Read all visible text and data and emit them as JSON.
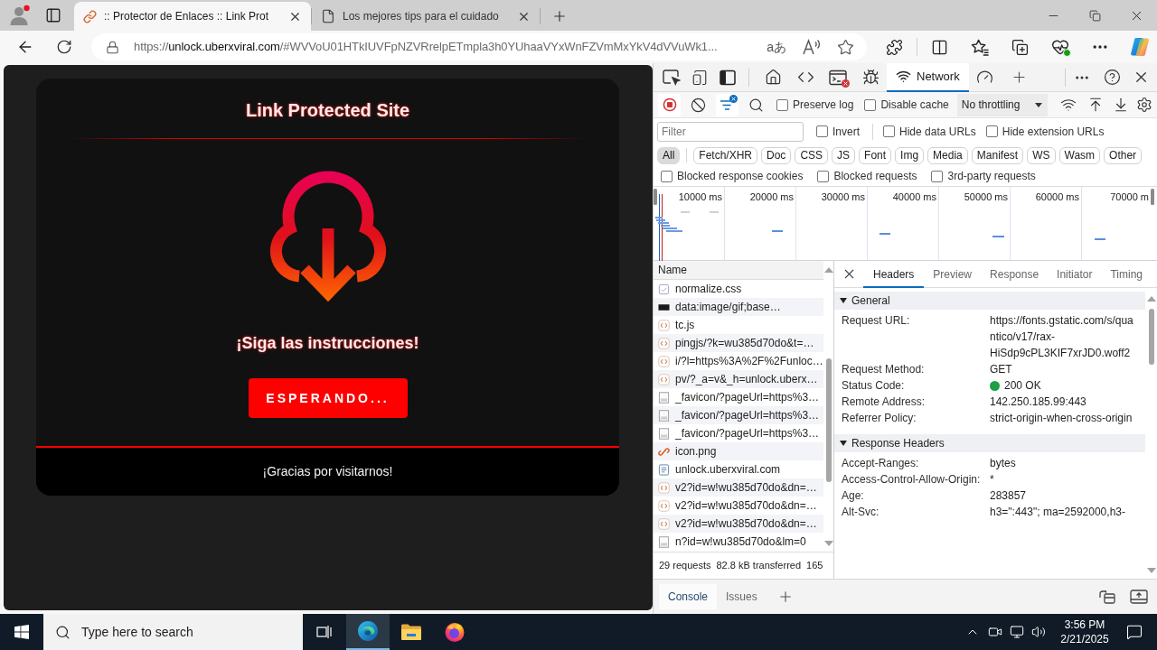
{
  "browser": {
    "tabs": [
      {
        "title": ":: Protector de Enlaces :: Link Prot",
        "kind": "link",
        "selected": true
      },
      {
        "title": "Los mejores tips para el cuidado",
        "kind": "page",
        "selected": false
      }
    ],
    "address": {
      "scheme": "https://",
      "host": "unlock.uberxviral.com",
      "path": "/#WVVoU01HTkIUVFpNZVRrelpETmpla3h0YUhaaVYxWnFZVmMxYkV4dVVuWk1...",
      "translate_glyph": "aあ"
    }
  },
  "page": {
    "title": "Link Protected Site",
    "message": "¡Siga las instrucciones!",
    "button": "ESPERANDO...",
    "footer": "¡Gracias por visitarnos!"
  },
  "devtools": {
    "panels": [
      {
        "kind": "welcome",
        "selected": false
      },
      {
        "kind": "elements",
        "selected": false
      },
      {
        "kind": "console",
        "selected": false,
        "has_errors": true
      },
      {
        "kind": "sources",
        "selected": false
      },
      {
        "kind": "network",
        "label": "Network",
        "selected": true
      },
      {
        "kind": "performance",
        "selected": false
      }
    ],
    "toolbar": {
      "recording": true,
      "filter_badge": true,
      "options": [
        {
          "label": "Preserve log",
          "checked": false
        },
        {
          "label": "Disable cache",
          "checked": false
        }
      ],
      "throttling": "No throttling"
    },
    "filter": {
      "placeholder": "Filter",
      "options": [
        {
          "label": "Invert",
          "checked": false
        },
        {
          "label": "Hide data URLs",
          "checked": false
        },
        {
          "label": "Hide extension URLs",
          "checked": false
        }
      ]
    },
    "types": [
      {
        "label": "All",
        "selected": true
      },
      {
        "label": "Fetch/XHR",
        "selected": false
      },
      {
        "label": "Doc",
        "selected": false
      },
      {
        "label": "CSS",
        "selected": false
      },
      {
        "label": "JS",
        "selected": false
      },
      {
        "label": "Font",
        "selected": false
      },
      {
        "label": "Img",
        "selected": false
      },
      {
        "label": "Media",
        "selected": false
      },
      {
        "label": "Manifest",
        "selected": false
      },
      {
        "label": "WS",
        "selected": false
      },
      {
        "label": "Wasm",
        "selected": false
      },
      {
        "label": "Other",
        "selected": false
      }
    ],
    "blocked": [
      {
        "label": "Blocked response cookies",
        "checked": false
      },
      {
        "label": "Blocked requests",
        "checked": false
      },
      {
        "label": "3rd-party requests",
        "checked": false
      }
    ],
    "overview": {
      "ticks": [
        "10000 ms",
        "20000 ms",
        "30000 ms",
        "40000 ms",
        "50000 ms",
        "60000 ms",
        "70000 m"
      ]
    },
    "requests": {
      "header": "Name",
      "rows": [
        {
          "name": "normalize.css",
          "kind": "css"
        },
        {
          "name": "data:image/gif;base…",
          "kind": "pixel"
        },
        {
          "name": "tc.js",
          "kind": "script"
        },
        {
          "name": "pingjs/?k=wu385d70do&t=…",
          "kind": "script"
        },
        {
          "name": "i/?l=https%3A%2F%2Funloc…",
          "kind": "script"
        },
        {
          "name": "pv/?_a=v&_h=unlock.uberx…",
          "kind": "script"
        },
        {
          "name": "_favicon/?pageUrl=https%3…",
          "kind": "image"
        },
        {
          "name": "_favicon/?pageUrl=https%3…",
          "kind": "image"
        },
        {
          "name": "_favicon/?pageUrl=https%3…",
          "kind": "image"
        },
        {
          "name": "icon.png",
          "kind": "thumbnail"
        },
        {
          "name": "unlock.uberxviral.com",
          "kind": "document"
        },
        {
          "name": "v2?id=w!wu385d70do&dn=…",
          "kind": "script"
        },
        {
          "name": "v2?id=w!wu385d70do&dn=…",
          "kind": "script"
        },
        {
          "name": "v2?id=w!wu385d70do&dn=…",
          "kind": "script"
        },
        {
          "name": "n?id=w!wu385d70do&lm=0",
          "kind": "image"
        }
      ],
      "summary": [
        "29 requests",
        "82.8 kB transferred",
        "165"
      ]
    },
    "details": {
      "tabs": [
        {
          "label": "Headers",
          "selected": true
        },
        {
          "label": "Preview",
          "selected": false
        },
        {
          "label": "Response",
          "selected": false
        },
        {
          "label": "Initiator",
          "selected": false
        },
        {
          "label": "Timing",
          "selected": false
        }
      ],
      "sections": [
        {
          "title": "General",
          "expanded": true,
          "rows": [
            {
              "label": "Request URL:",
              "value": "https://fonts.gstatic.com/s/quantico/v17/rax-HiSdp9cPL3KIF7xrJD0.woff2"
            },
            {
              "label": "Request Method:",
              "value": "GET"
            },
            {
              "label": "Status Code:",
              "value": "200 OK",
              "kind": "status"
            },
            {
              "label": "Remote Address:",
              "value": "142.250.185.99:443"
            },
            {
              "label": "Referrer Policy:",
              "value": "strict-origin-when-cross-origin"
            }
          ]
        },
        {
          "title": "Response Headers",
          "expanded": true,
          "rows": [
            {
              "label": "Accept-Ranges:",
              "value": "bytes"
            },
            {
              "label": "Access-Control-Allow-Origin:",
              "value": "*"
            },
            {
              "label": "Age:",
              "value": "283857"
            },
            {
              "label": "Alt-Svc:",
              "value": "h3=\":443\"; ma=2592000,h3-"
            }
          ]
        }
      ]
    },
    "drawer": {
      "tabs": [
        {
          "label": "Console",
          "selected": true
        },
        {
          "label": "Issues",
          "selected": false
        }
      ]
    }
  },
  "taskbar": {
    "search": {
      "placeholder": "Type here to search"
    },
    "apps": [
      {
        "kind": "edge",
        "selected": true
      },
      {
        "kind": "files",
        "selected": false
      },
      {
        "kind": "firefox",
        "selected": false
      }
    ],
    "time": "3:56 PM",
    "date": "2/21/2025"
  }
}
